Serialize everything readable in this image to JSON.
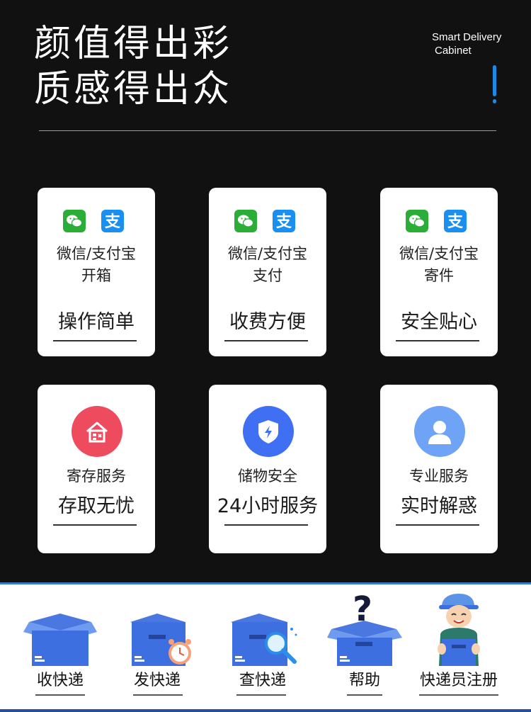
{
  "headline": {
    "line1": "颜值得出彩",
    "line2": "质感得出众"
  },
  "brand": {
    "line1": "Smart Delivery",
    "line2": "Cabinet"
  },
  "colors": {
    "accent": "#1e88e5",
    "wechat": "#2aae37",
    "alipay": "#1a8ff2",
    "red_icon": "#ef4b5f",
    "blue_icon": "#3f6ff2",
    "person_icon": "#6ea3f5"
  },
  "cards_payment": [
    {
      "sub1": "微信/支付宝",
      "sub2": "开箱",
      "big": "操作简单"
    },
    {
      "sub1": "微信/支付宝",
      "sub2": "支付",
      "big": "收费方便"
    },
    {
      "sub1": "微信/支付宝",
      "sub2": "寄件",
      "big": "安全贴心"
    }
  ],
  "cards_service": [
    {
      "icon": "home-box-icon",
      "sub": "寄存服务",
      "big": "存取无忧"
    },
    {
      "icon": "shield-bolt-icon",
      "sub": "储物安全",
      "big": "24小时服务"
    },
    {
      "icon": "person-icon",
      "sub": "专业服务",
      "big": "实时解惑"
    }
  ],
  "bottom_nav": [
    {
      "icon": "box-icon",
      "label": "收快递"
    },
    {
      "icon": "box-clock-icon",
      "label": "发快递"
    },
    {
      "icon": "box-search-icon",
      "label": "查快递"
    },
    {
      "icon": "box-question-icon",
      "label": "帮助"
    },
    {
      "icon": "courier-icon",
      "label": "快递员注册"
    }
  ]
}
